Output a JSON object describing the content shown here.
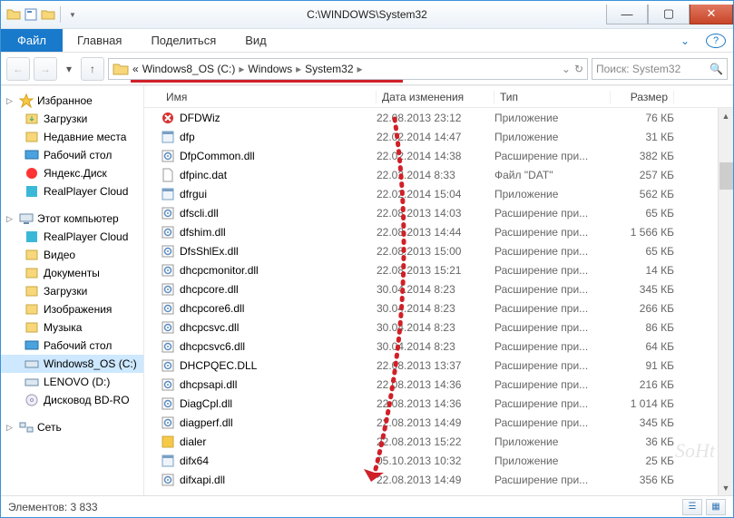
{
  "titlebar": {
    "title": "C:\\WINDOWS\\System32"
  },
  "menubar": {
    "file": "Файл",
    "items": [
      "Главная",
      "Поделиться",
      "Вид"
    ]
  },
  "breadcrumb": {
    "prefix": "«",
    "parts": [
      "Windows8_OS (C:)",
      "Windows",
      "System32"
    ]
  },
  "search": {
    "placeholder": "Поиск: System32"
  },
  "sidebar": {
    "fav_head": "Избранное",
    "fav": [
      "Загрузки",
      "Недавние места",
      "Рабочий стол",
      "Яндекс.Диск",
      "RealPlayer Cloud"
    ],
    "pc_head": "Этот компьютер",
    "pc": [
      "RealPlayer Cloud",
      "Видео",
      "Документы",
      "Загрузки",
      "Изображения",
      "Музыка",
      "Рабочий стол",
      "Windows8_OS (C:)",
      "LENOVO (D:)",
      "Дисковод BD-RO"
    ],
    "net_head": "Сеть"
  },
  "columns": {
    "name": "Имя",
    "date": "Дата изменения",
    "type": "Тип",
    "size": "Размер"
  },
  "files": [
    {
      "ico": "app-red",
      "name": "DFDWiz",
      "date": "22.08.2013 23:12",
      "type": "Приложение",
      "size": "76 КБ"
    },
    {
      "ico": "app",
      "name": "dfp",
      "date": "22.02.2014 14:47",
      "type": "Приложение",
      "size": "31 КБ"
    },
    {
      "ico": "dll",
      "name": "DfpCommon.dll",
      "date": "22.02.2014 14:38",
      "type": "Расширение при...",
      "size": "382 КБ"
    },
    {
      "ico": "dat",
      "name": "dfpinc.dat",
      "date": "22.02.2014 8:33",
      "type": "Файл \"DAT\"",
      "size": "257 КБ"
    },
    {
      "ico": "app",
      "name": "dfrgui",
      "date": "22.02.2014 15:04",
      "type": "Приложение",
      "size": "562 КБ"
    },
    {
      "ico": "dll",
      "name": "dfscli.dll",
      "date": "22.08.2013 14:03",
      "type": "Расширение при...",
      "size": "65 КБ"
    },
    {
      "ico": "dll",
      "name": "dfshim.dll",
      "date": "22.08.2013 14:44",
      "type": "Расширение при...",
      "size": "1 566 КБ"
    },
    {
      "ico": "dll",
      "name": "DfsShlEx.dll",
      "date": "22.08.2013 15:00",
      "type": "Расширение при...",
      "size": "65 КБ"
    },
    {
      "ico": "dll",
      "name": "dhcpcmonitor.dll",
      "date": "22.08.2013 15:21",
      "type": "Расширение при...",
      "size": "14 КБ"
    },
    {
      "ico": "dll",
      "name": "dhcpcore.dll",
      "date": "30.04.2014 8:23",
      "type": "Расширение при...",
      "size": "345 КБ"
    },
    {
      "ico": "dll",
      "name": "dhcpcore6.dll",
      "date": "30.04.2014 8:23",
      "type": "Расширение при...",
      "size": "266 КБ"
    },
    {
      "ico": "dll",
      "name": "dhcpcsvc.dll",
      "date": "30.04.2014 8:23",
      "type": "Расширение при...",
      "size": "86 КБ"
    },
    {
      "ico": "dll",
      "name": "dhcpcsvc6.dll",
      "date": "30.04.2014 8:23",
      "type": "Расширение при...",
      "size": "64 КБ"
    },
    {
      "ico": "dll",
      "name": "DHCPQEC.DLL",
      "date": "22.08.2013 13:37",
      "type": "Расширение при...",
      "size": "91 КБ"
    },
    {
      "ico": "dll",
      "name": "dhcpsapi.dll",
      "date": "22.08.2013 14:36",
      "type": "Расширение при...",
      "size": "216 КБ"
    },
    {
      "ico": "dll",
      "name": "DiagCpl.dll",
      "date": "22.08.2013 14:36",
      "type": "Расширение при...",
      "size": "1 014 КБ"
    },
    {
      "ico": "dll",
      "name": "diagperf.dll",
      "date": "22.08.2013 14:49",
      "type": "Расширение при...",
      "size": "345 КБ"
    },
    {
      "ico": "app-y",
      "name": "dialer",
      "date": "22.08.2013 15:22",
      "type": "Приложение",
      "size": "36 КБ"
    },
    {
      "ico": "app",
      "name": "difx64",
      "date": "05.10.2013 10:32",
      "type": "Приложение",
      "size": "25 КБ"
    },
    {
      "ico": "dll",
      "name": "difxapi.dll",
      "date": "22.08.2013 14:49",
      "type": "Расширение при...",
      "size": "356 КБ"
    }
  ],
  "status": {
    "count_label": "Элементов:",
    "count": "3 833"
  },
  "watermark": "SoHt"
}
